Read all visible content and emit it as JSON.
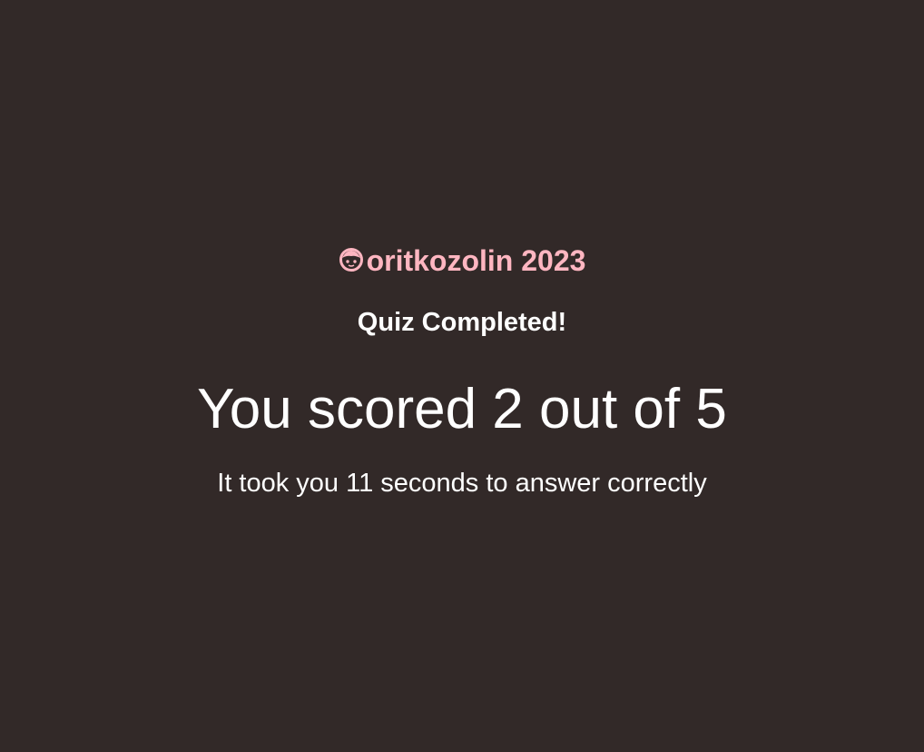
{
  "brand": {
    "icon": "child-face-icon",
    "label": "oritkozolin 2023",
    "color": "#ffb6c1"
  },
  "quiz": {
    "status": "Quiz Completed!",
    "score_text": "You scored 2 out of 5",
    "time_text": "It took you 11 seconds to answer correctly"
  },
  "colors": {
    "background": "#322928",
    "text": "#ffffff"
  }
}
